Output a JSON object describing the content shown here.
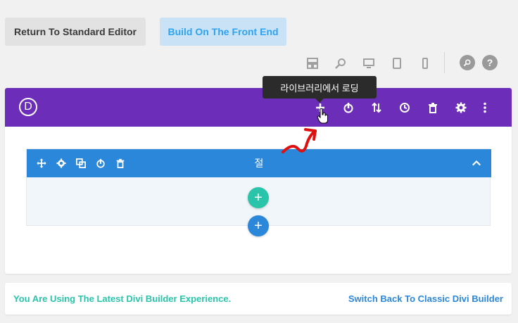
{
  "top_buttons": {
    "standard_editor": "Return To Standard Editor",
    "front_end": "Build On The Front End"
  },
  "view_modes": [
    "wireframe-icon",
    "zoom-icon",
    "desktop-icon",
    "tablet-icon",
    "phone-icon"
  ],
  "help": {
    "search_icon": "search-icon",
    "help_label": "?"
  },
  "builder_header": {
    "logo": "D",
    "tooltip": "라이브러리에서 로딩",
    "icons": [
      "add-icon",
      "power-icon",
      "sort-icon",
      "history-icon",
      "trash-icon",
      "gear-icon",
      "more-icon"
    ]
  },
  "section": {
    "title": "절",
    "icons": [
      "move-icon",
      "gear-icon",
      "duplicate-icon",
      "power-icon",
      "trash-icon"
    ]
  },
  "add_buttons": {
    "row": "+",
    "section": "+"
  },
  "footer": {
    "message": "You Are Using The Latest Divi Builder Experience.",
    "switch_link": "Switch Back To Classic Divi Builder"
  },
  "colors": {
    "header": "#6c2eb9",
    "section_bar": "#2b87da",
    "add_green": "#29c4a9",
    "tooltip": "#2b2b2b"
  }
}
